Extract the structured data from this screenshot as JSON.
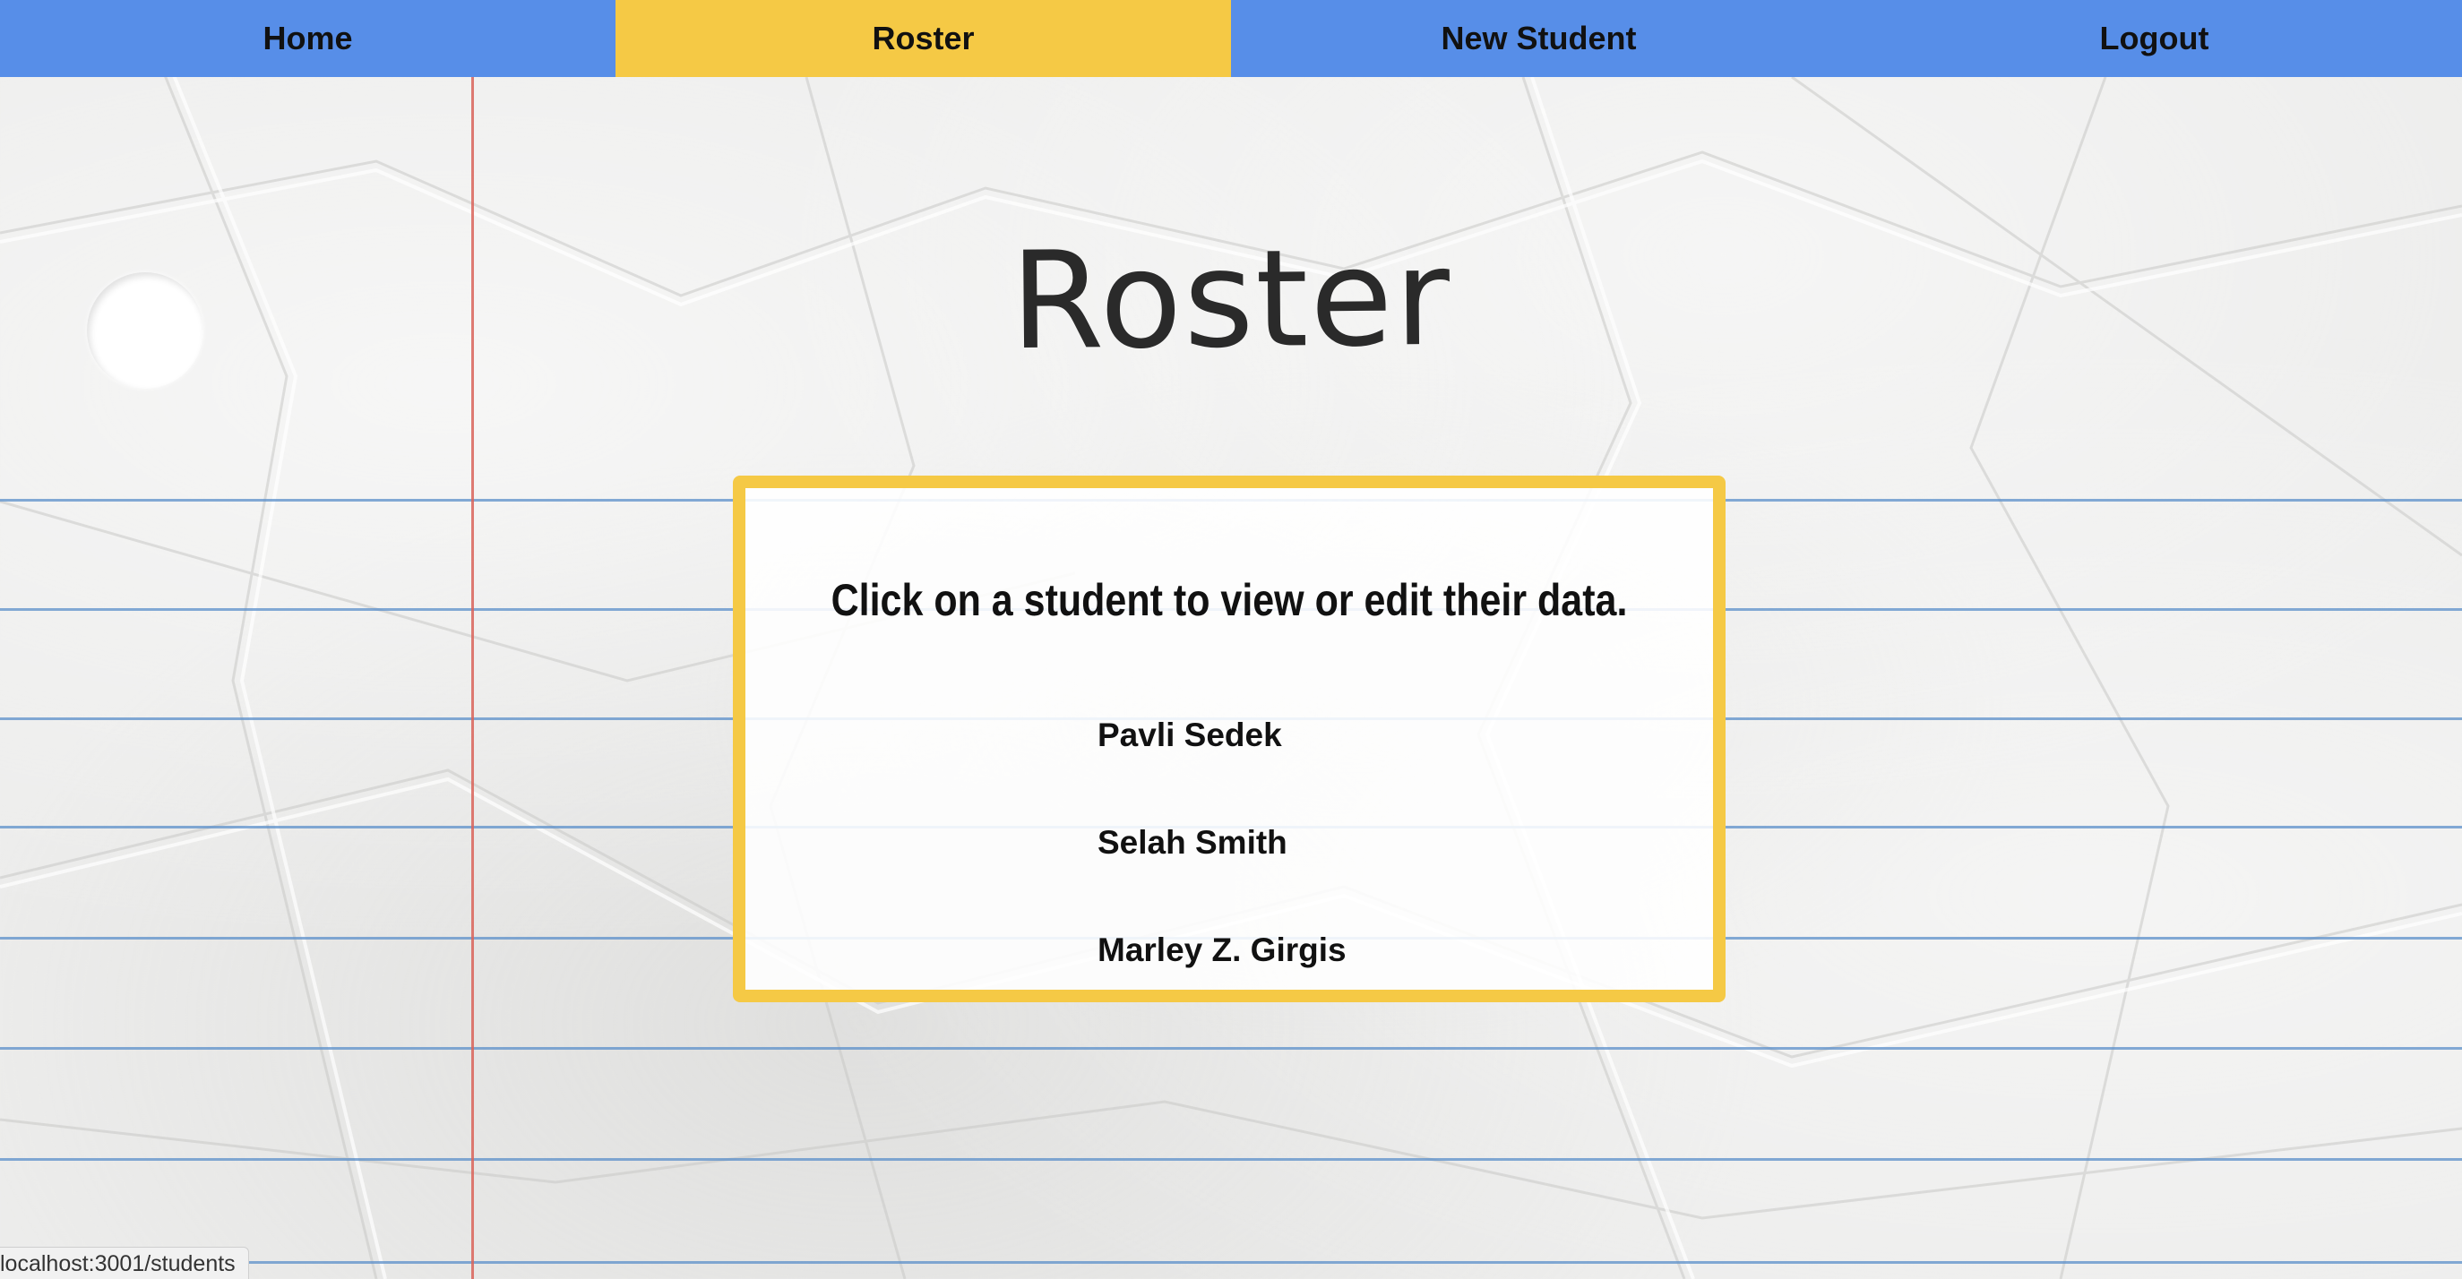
{
  "nav": {
    "items": [
      {
        "label": "Home",
        "active": false
      },
      {
        "label": "Roster",
        "active": true
      },
      {
        "label": "New Student",
        "active": false
      },
      {
        "label": "Logout",
        "active": false
      }
    ]
  },
  "page": {
    "title": "Roster"
  },
  "card": {
    "instructions": "Click on a student to view or edit their data.",
    "students": [
      {
        "name": "Pavli Sedek"
      },
      {
        "name": "Selah Smith"
      },
      {
        "name": "Marley Z. Girgis"
      }
    ]
  },
  "status_bar": {
    "url": "localhost:3001/students"
  },
  "colors": {
    "nav_background": "#578ee8",
    "nav_active": "#f5c945",
    "card_border": "#f5c945",
    "ruled_line": "#5b8fc9",
    "margin_line": "#d9645a"
  }
}
